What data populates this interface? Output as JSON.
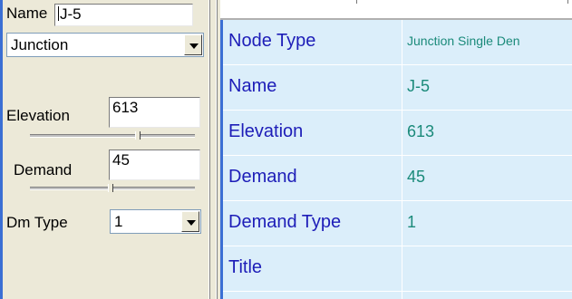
{
  "left_panel": {
    "name_label": "Name",
    "name_value": "J-5",
    "node_type_selected": "Junction",
    "elevation_label": "Elevation",
    "elevation_value": "613",
    "demand_label": "Demand",
    "demand_value": "45",
    "dm_type_label": "Dm Type",
    "dm_type_selected": "1"
  },
  "grid": {
    "rows": [
      {
        "name": "Node Type",
        "value": "Junction Single Den"
      },
      {
        "name": "Name",
        "value": "J-5"
      },
      {
        "name": "Elevation",
        "value": "613"
      },
      {
        "name": "Demand",
        "value": "45"
      },
      {
        "name": "Demand Type",
        "value": "1"
      },
      {
        "name": "Title",
        "value": ""
      }
    ]
  },
  "colors": {
    "panel_bg": "#ece9d8",
    "grid_bg": "#dbeefa",
    "name_text": "#1d1db8",
    "value_text": "#1a8a7a",
    "accent_border": "#3b6fd4"
  }
}
